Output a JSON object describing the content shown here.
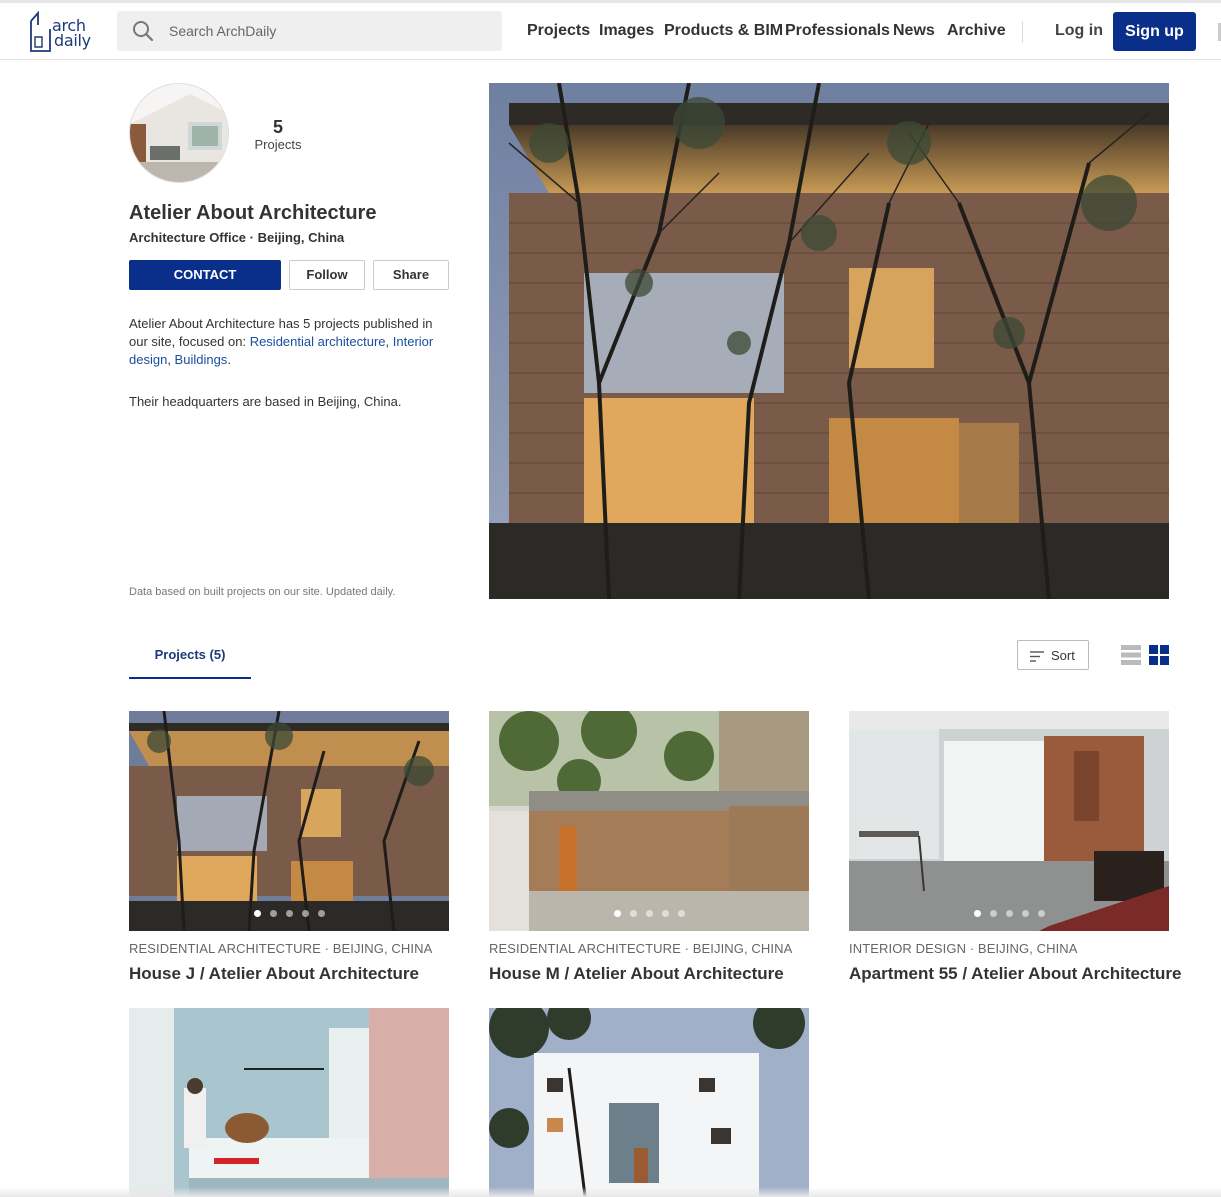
{
  "header": {
    "logo_line1": "arch",
    "logo_line2": "daily",
    "search_placeholder": "Search ArchDaily",
    "nav": [
      "Projects",
      "Images",
      "Products & BIM",
      "Professionals",
      "News",
      "Archive"
    ],
    "login_label": "Log in",
    "signup_label": "Sign up"
  },
  "profile": {
    "projects_count": "5",
    "projects_label": "Projects",
    "name": "Atelier About Architecture",
    "subtitle": "Architecture Office · Beijing, China",
    "contact_label": "CONTACT",
    "follow_label": "Follow",
    "share_label": "Share",
    "desc_prefix": "Atelier About Architecture has 5 projects published in our site, focused on: ",
    "focus_links": [
      "Residential architecture",
      "Interior design",
      "Buildings"
    ],
    "hq_text": "Their headquarters are based in Beijing, China.",
    "data_note": "Data based on built projects on our site. Updated daily."
  },
  "tabs": {
    "projects_tab": "Projects (5)",
    "sort_label": "Sort"
  },
  "projects": [
    {
      "category": "RESIDENTIAL ARCHITECTURE · BEIJING, CHINA",
      "title": "House J / Atelier About Architecture",
      "active_dot": 0
    },
    {
      "category": "RESIDENTIAL ARCHITECTURE · BEIJING, CHINA",
      "title": "House M / Atelier About Architecture",
      "active_dot": 0
    },
    {
      "category": "INTERIOR DESIGN · BEIJING, CHINA",
      "title": "Apartment 55 / Atelier About Architecture",
      "active_dot": 0
    },
    {
      "category": "",
      "title": ""
    },
    {
      "category": "",
      "title": ""
    }
  ],
  "colors": {
    "brand_blue": "#0a2f8a",
    "link_blue": "#1a4ea0"
  }
}
